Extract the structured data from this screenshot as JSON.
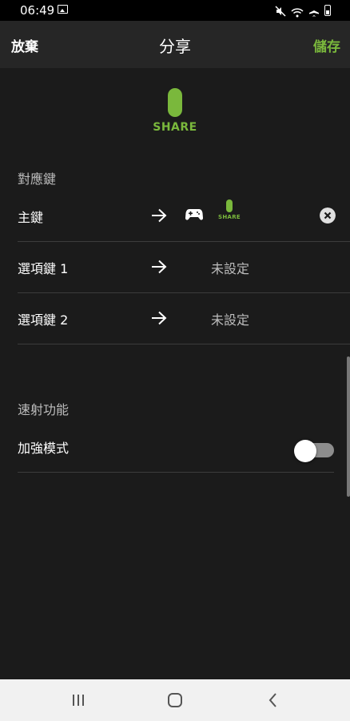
{
  "status_bar": {
    "time": "06:49"
  },
  "app_bar": {
    "discard_label": "放棄",
    "title": "分享",
    "save_label": "儲存"
  },
  "hero": {
    "label": "SHARE",
    "accent_color": "#7ab83c"
  },
  "mapping_section": {
    "title": "對應鍵",
    "rows": [
      {
        "label": "主鍵",
        "mapped": {
          "icon": "gamepad-icon",
          "button_label": "SHARE"
        }
      },
      {
        "label": "選項鍵 1",
        "value": "未設定"
      },
      {
        "label": "選項鍵 2",
        "value": "未設定"
      }
    ]
  },
  "turbo_section": {
    "title": "速射功能",
    "rows": [
      {
        "label": "加強模式",
        "toggle_on": false
      }
    ]
  },
  "nav_bar": {
    "icons": [
      "recent-apps-icon",
      "home-icon",
      "back-icon"
    ]
  }
}
